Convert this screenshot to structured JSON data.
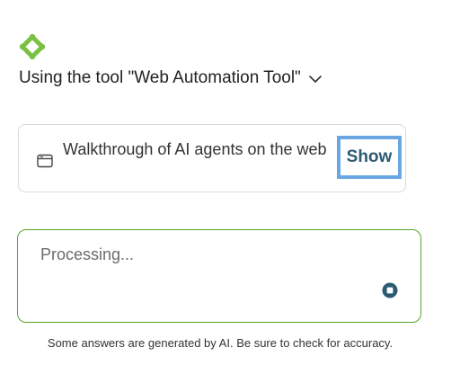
{
  "header": {
    "logo_icon": "green-diamond-logo-icon",
    "tool_label": "Using the tool \"Web Automation Tool\"",
    "dropdown_icon": "chevron-down-icon"
  },
  "card": {
    "icon": "browser-window-icon",
    "text": "Walkthrough of AI agents on the web",
    "show_label": "Show"
  },
  "input": {
    "placeholder": "Processing...",
    "stop_icon": "stop-icon"
  },
  "footer": {
    "disclaimer": "Some answers are generated by AI. Be sure to check for accuracy."
  },
  "colors": {
    "logo": "#7ac143",
    "input_border": "#5aa532",
    "show_focus": "#6aa6e3",
    "show_text": "#2d5a73",
    "stop": "#2d5a73"
  }
}
